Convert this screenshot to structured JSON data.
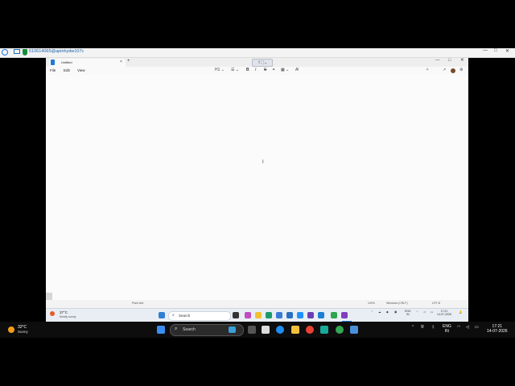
{
  "remote_bar": {
    "session_id": "510614065@apinhydw107c",
    "minimize": "—",
    "maximize": "□",
    "close": "✕"
  },
  "window": {
    "tab_title": "Untitled",
    "tab_close": "×",
    "tab_add": "+",
    "overlay_label": "⁞⁞ ⛶ ⌄",
    "min": "—",
    "max": "□",
    "close": "✕"
  },
  "menu": {
    "file": "File",
    "edit": "Edit",
    "view": "View"
  },
  "toolbar": {
    "heading": "H1 ⌄",
    "list": "☰ ⌄",
    "bold": "B",
    "italic": "I",
    "strike": "S",
    "link": "⚭",
    "table": "▦ ⌄",
    "clear": "A̸"
  },
  "status": {
    "format": "Plain text",
    "zoom": "100%",
    "line_ending": "Windows (CRLF)",
    "encoding": "UTF-8"
  },
  "inner_taskbar": {
    "temp": "37°C",
    "condition": "Mostly sunny",
    "search": "Search",
    "lang_top": "ENG",
    "lang_bottom": "IN",
    "time": "17:21",
    "date": "14-07-2026"
  },
  "outer_taskbar": {
    "temp": "32°C",
    "condition": "Sunny",
    "search": "Search",
    "lang_top": "ENG",
    "lang_bottom": "IN",
    "time": "17:21",
    "date": "14-07-2026"
  },
  "colors": {
    "accent": "#1d7ad6",
    "taskbar_dark": "#0d0d0d",
    "editor_bg": "#fbfbfb"
  }
}
